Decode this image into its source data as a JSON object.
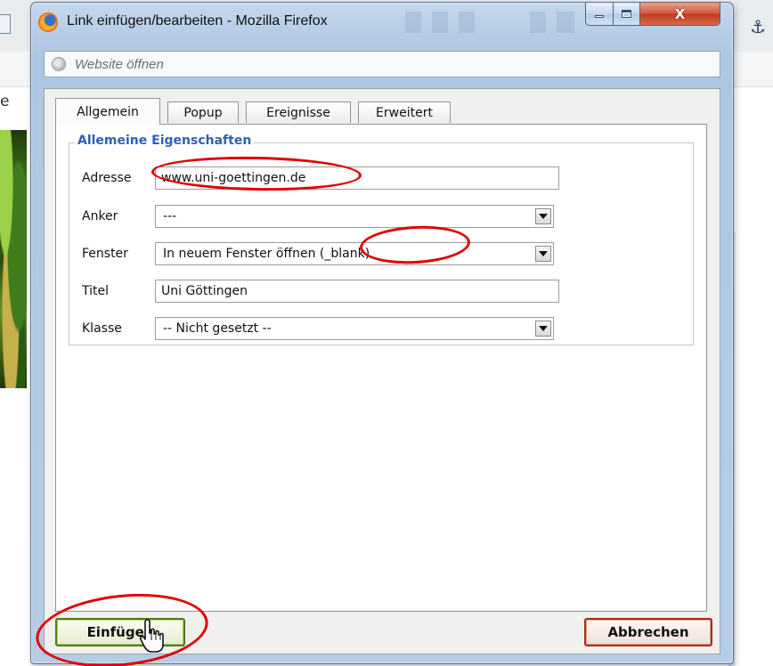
{
  "window": {
    "title": "Link einfügen/bearbeiten - Mozilla Firefox",
    "url_placeholder": "Website öffnen",
    "close_symbol": "X"
  },
  "background": {
    "left_letter": "e",
    "anchor_symbol": "⚓"
  },
  "tabs": [
    {
      "label": "Allgemein",
      "active": true
    },
    {
      "label": "Popup",
      "active": false
    },
    {
      "label": "Ereignisse",
      "active": false
    },
    {
      "label": "Erweitert",
      "active": false
    }
  ],
  "section": {
    "legend": "Allemeine Eigenschaften"
  },
  "form": {
    "adresse": {
      "label": "Adresse",
      "value": "www.uni-goettingen.de"
    },
    "anker": {
      "label": "Anker",
      "value": "---"
    },
    "fenster": {
      "label": "Fenster",
      "value": "In neuem Fenster öffnen (_blank)"
    },
    "titel": {
      "label": "Titel",
      "value": "Uni Göttingen"
    },
    "klasse": {
      "label": "Klasse",
      "value": "-- Nicht gesetzt --"
    }
  },
  "buttons": {
    "insert": "Einfügen",
    "cancel": "Abbrechen"
  },
  "colors": {
    "annotation": "#e00000",
    "legend": "#2b62b0",
    "insert_border": "#4f7c12",
    "cancel_border": "#a3311a"
  },
  "icons": {
    "browser": "firefox-icon",
    "site": "globe-icon",
    "cursor": "hand-pointer-icon"
  }
}
